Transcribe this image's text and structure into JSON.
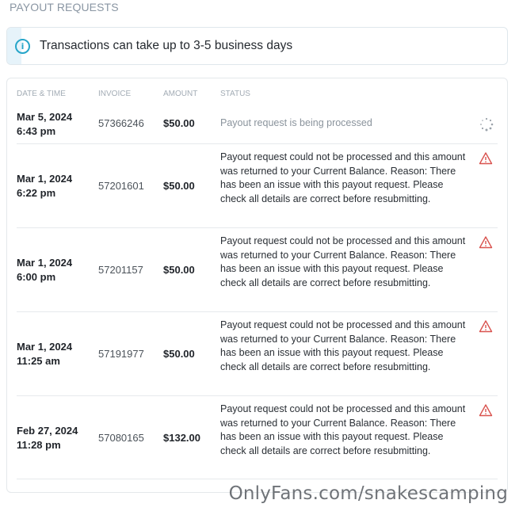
{
  "page": {
    "title": "PAYOUT REQUESTS"
  },
  "banner": {
    "icon": "info-icon",
    "text": "Transactions can take up to 3-5 business days",
    "accent_color": "#26a5c9"
  },
  "table": {
    "headers": {
      "date": "DATE & TIME",
      "invoice": "INVOICE",
      "amount": "AMOUNT",
      "status": "STATUS"
    },
    "rows": [
      {
        "date": "Mar 5, 2024",
        "time": "6:43 pm",
        "invoice": "57366246",
        "amount": "$50.00",
        "status": "Payout request is being processed",
        "status_type": "pending",
        "icon": "loading-spinner-icon"
      },
      {
        "date": "Mar 1, 2024",
        "time": "6:22 pm",
        "invoice": "57201601",
        "amount": "$50.00",
        "status": "Payout request could not be processed and this amount was returned to your Current Balance. Reason: There has been an issue with this payout request. Please check all details are correct before resubmitting.",
        "status_type": "failed",
        "icon": "warning-icon"
      },
      {
        "date": "Mar 1, 2024",
        "time": "6:00 pm",
        "invoice": "57201157",
        "amount": "$50.00",
        "status": "Payout request could not be processed and this amount was returned to your Current Balance. Reason: There has been an issue with this payout request. Please check all details are correct before resubmitting.",
        "status_type": "failed",
        "icon": "warning-icon"
      },
      {
        "date": "Mar 1, 2024",
        "time": "11:25 am",
        "invoice": "57191977",
        "amount": "$50.00",
        "status": "Payout request could not be processed and this amount was returned to your Current Balance. Reason: There has been an issue with this payout request. Please check all details are correct before resubmitting.",
        "status_type": "failed",
        "icon": "warning-icon"
      },
      {
        "date": "Feb 27, 2024",
        "time": "11:28 pm",
        "invoice": "57080165",
        "amount": "$132.00",
        "status": "Payout request could not be processed and this amount was returned to your Current Balance. Reason: There has been an issue with this payout request. Please check all details are correct before resubmitting.",
        "status_type": "failed",
        "icon": "warning-icon"
      }
    ]
  },
  "colors": {
    "warning": "#d9534f",
    "pending": "#8a939c"
  },
  "watermark": "OnlyFans.com/snakescamping"
}
